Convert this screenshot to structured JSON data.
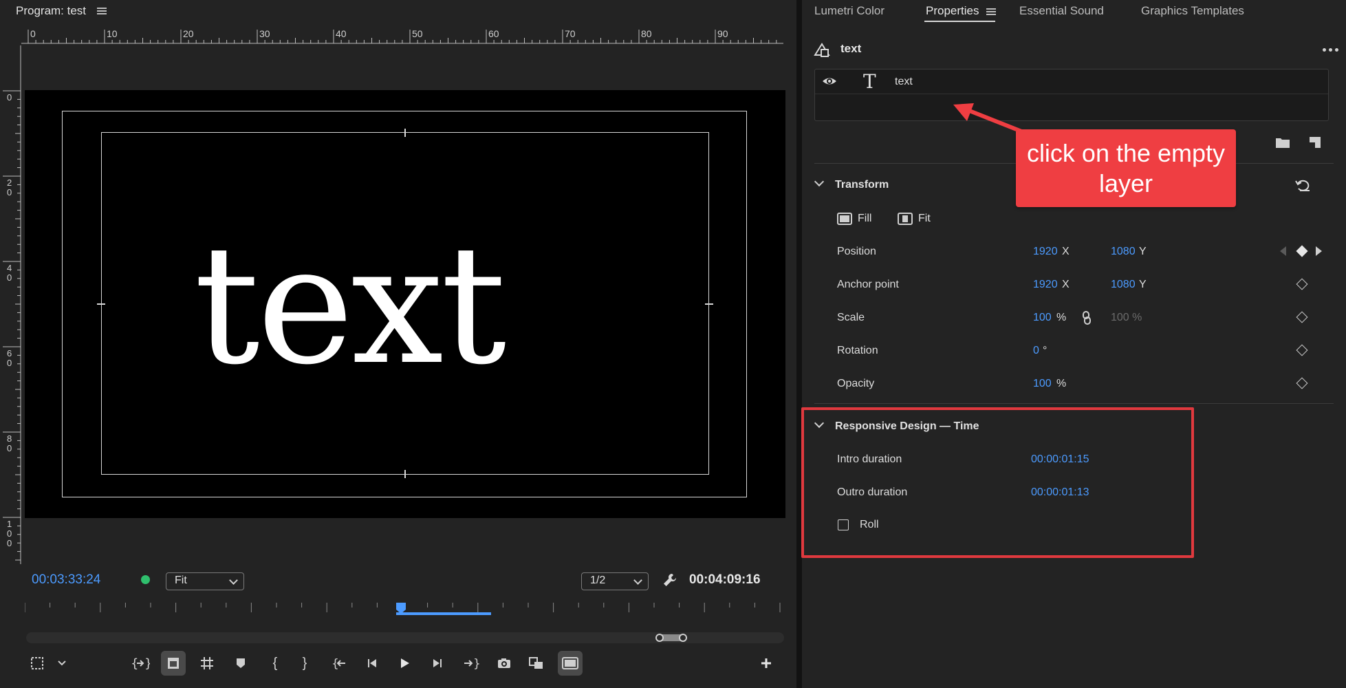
{
  "program": {
    "title": "Program: test",
    "canvas_text": "text",
    "timecode_current": "00:03:33:24",
    "zoom_select": "Fit",
    "resolution_select": "1/2",
    "timecode_duration": "00:04:09:16",
    "ruler_top_labels": [
      "0",
      "10",
      "20",
      "30",
      "40",
      "50",
      "60",
      "70",
      "80",
      "90"
    ],
    "ruler_left_labels": [
      "0",
      "20",
      "40",
      "60",
      "80",
      "100"
    ]
  },
  "tabs": {
    "lumetri": "Lumetri Color",
    "properties": "Properties",
    "essential_sound": "Essential Sound",
    "graphics_templates": "Graphics Templates"
  },
  "props": {
    "name": "text",
    "layer_name": "text",
    "transform": {
      "title": "Transform",
      "fill_label": "Fill",
      "fit_label": "Fit",
      "position": {
        "label": "Position",
        "x": "1920",
        "x_unit": "X",
        "y": "1080",
        "y_unit": "Y"
      },
      "anchor": {
        "label": "Anchor point",
        "x": "1920",
        "x_unit": "X",
        "y": "1080",
        "y_unit": "Y"
      },
      "scale": {
        "label": "Scale",
        "value": "100",
        "unit": "%",
        "second": "100 %"
      },
      "rotation": {
        "label": "Rotation",
        "value": "0",
        "unit": "°"
      },
      "opacity": {
        "label": "Opacity",
        "value": "100",
        "unit": "%"
      }
    },
    "responsive": {
      "title": "Responsive Design — Time",
      "intro_label": "Intro duration",
      "intro_value": "00:00:01:15",
      "outro_label": "Outro duration",
      "outro_value": "00:00:01:13",
      "roll_label": "Roll",
      "roll_checked": false
    }
  },
  "annotation": {
    "callout_text": "click on the empty layer",
    "color": "#ef3e42"
  },
  "colors": {
    "accent_blue": "#4c9bff",
    "panel_bg": "#232323",
    "canvas_bg": "#000000"
  }
}
